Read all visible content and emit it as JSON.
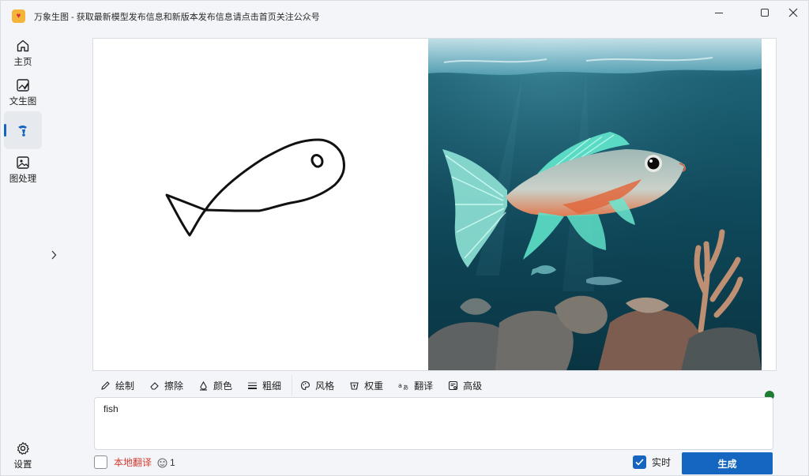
{
  "window": {
    "title": "万象生图 - 获取最新模型发布信息和新版本发布信息请点击首页关注公众号"
  },
  "sidebar": {
    "items": [
      {
        "label": "主页",
        "icon": "home-icon"
      },
      {
        "label": "文生图",
        "icon": "image-edit-icon"
      },
      {
        "label": "",
        "icon": "paint-brush-icon",
        "active": true
      },
      {
        "label": "图处理",
        "icon": "image-icon"
      }
    ],
    "settings_label": "设置"
  },
  "toolbar": {
    "items": [
      {
        "label": "绘制",
        "icon": "pencil-icon"
      },
      {
        "label": "擦除",
        "icon": "eraser-icon"
      },
      {
        "label": "颜色",
        "icon": "color-fill-icon"
      },
      {
        "label": "粗细",
        "icon": "line-weight-icon"
      },
      {
        "label": "风格",
        "icon": "palette-icon"
      },
      {
        "label": "权重",
        "icon": "weight-icon"
      },
      {
        "label": "翻译",
        "icon": "translate-icon"
      },
      {
        "label": "高级",
        "icon": "advanced-settings-icon"
      }
    ]
  },
  "prompt": {
    "value": "fish"
  },
  "bottom": {
    "local_translate_label": "本地翻译",
    "local_translate_checked": false,
    "count": "1",
    "realtime_label": "实时",
    "realtime_checked": true,
    "generate_label": "生成"
  },
  "colors": {
    "accent": "#1565c0",
    "status_online": "#1e7d32",
    "local_translate_text": "#d43c2f"
  }
}
